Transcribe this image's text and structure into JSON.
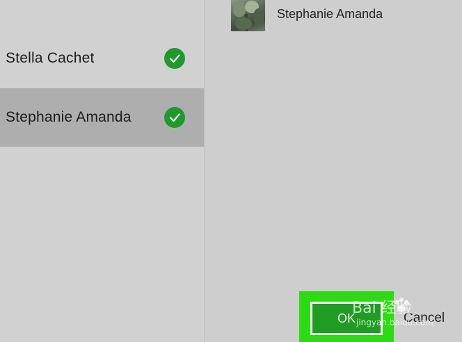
{
  "contacts": [
    {
      "name": "Stella Cachet",
      "checked": true,
      "selected": false
    },
    {
      "name": "Stephanie Amanda",
      "checked": true,
      "selected": true
    }
  ],
  "selected_panel": {
    "items": [
      {
        "name": "Stephanie Amanda",
        "thumbnail": "plant-photo",
        "remove_icon": "close-icon"
      }
    ]
  },
  "footer": {
    "ok_label": "OK",
    "cancel_label": "Cancel"
  },
  "watermark": {
    "text_main": "Bai  经验",
    "text_sub": "jingyan.baidu.com"
  },
  "colors": {
    "check_green": "#1e9a2c",
    "ok_green": "#1f9c22",
    "highlight_green": "#2bdc12",
    "selected_row": "#aeaeae"
  }
}
